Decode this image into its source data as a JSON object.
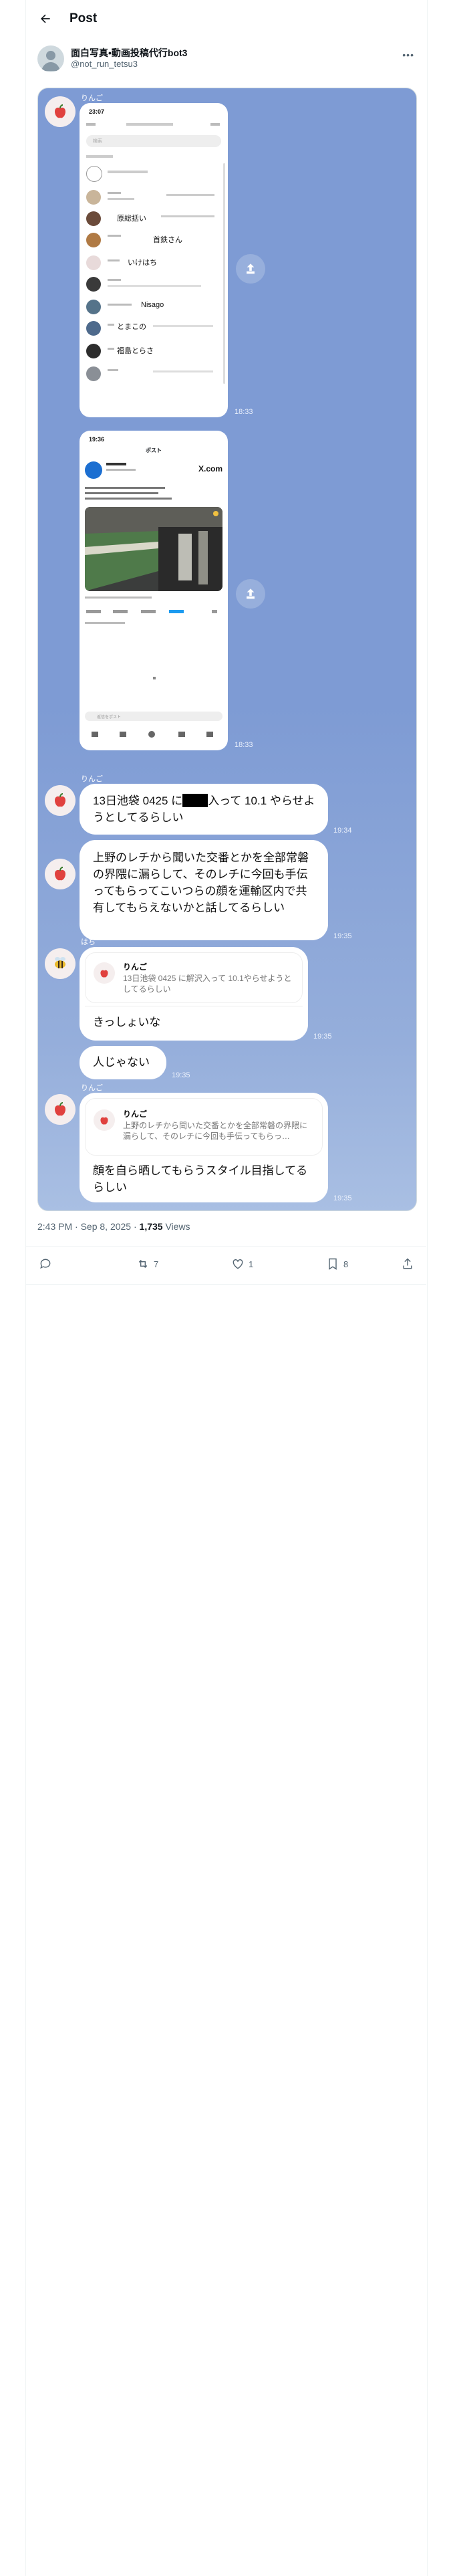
{
  "header": {
    "title": "Post"
  },
  "author": {
    "name": "面白写真•動画投稿代行bot3",
    "handle": "@not_run_tetsu3"
  },
  "icons": {
    "back": "arrow-left-icon",
    "more": "more-icon",
    "share": "share-icon",
    "reply": "reply-icon",
    "retweet": "retweet-icon",
    "like": "heart-icon",
    "bookmark": "bookmark-icon"
  },
  "colors": {
    "chat_background": "#7e9bd4",
    "accent_blue": "#1d9bf0"
  },
  "chat": {
    "shot1": {
      "user": "りんご",
      "time": "18:33",
      "status_time": "23:07",
      "search_placeholder": "検索",
      "rows": [
        {
          "name": "原総括い"
        },
        {
          "name": "首鉄さん"
        },
        {
          "name": "いけはち"
        },
        {
          "name": "Nisago"
        },
        {
          "name": "とまこの"
        },
        {
          "name": "福島とらさ"
        }
      ]
    },
    "shot2": {
      "time": "18:33",
      "status_time": "19:36",
      "topbar_title": "ポスト",
      "logo": "X.com",
      "reply_placeholder": "返信をポスト"
    },
    "msg1": {
      "user": "りんご",
      "text_before": "13日池袋 0425 に",
      "text_after": "入って 10.1 やらせようとしてるらしい",
      "time": "19:34"
    },
    "msg2": {
      "text": "上野のレチから聞いた交番とかを全部常磐の界隈に漏らして、そのレチに今回も手伝ってもらってこいつらの顔を運輸区内で共有してもらえないかと話してるらしい",
      "time": "19:35"
    },
    "msg3": {
      "user": "はち",
      "quote_name": "りんご",
      "quote_text": "13日池袋 0425 に解沢入って 10.1やらせようとしてるらしい",
      "text": "きっしょいな",
      "time": "19:35"
    },
    "msg4": {
      "text": "人じゃない",
      "time": "19:35"
    },
    "msg5": {
      "user": "りんご",
      "quote_name": "りんご",
      "quote_text": "上野のレチから聞いた交番とかを全部常磐の界隈に漏らして、そのレチに今回も手伝ってもらっ…",
      "text": "顔を自ら晒してもらうスタイル目指してるらしい",
      "time": "19:35"
    }
  },
  "footer": {
    "timestamp": "2:43 PM · Sep 8, 2025 · ",
    "views": "1,735",
    "views_label": " Views"
  },
  "actions": {
    "reply_count": "",
    "retweet_count": "7",
    "like_count": "1",
    "bookmark_count": "8"
  }
}
